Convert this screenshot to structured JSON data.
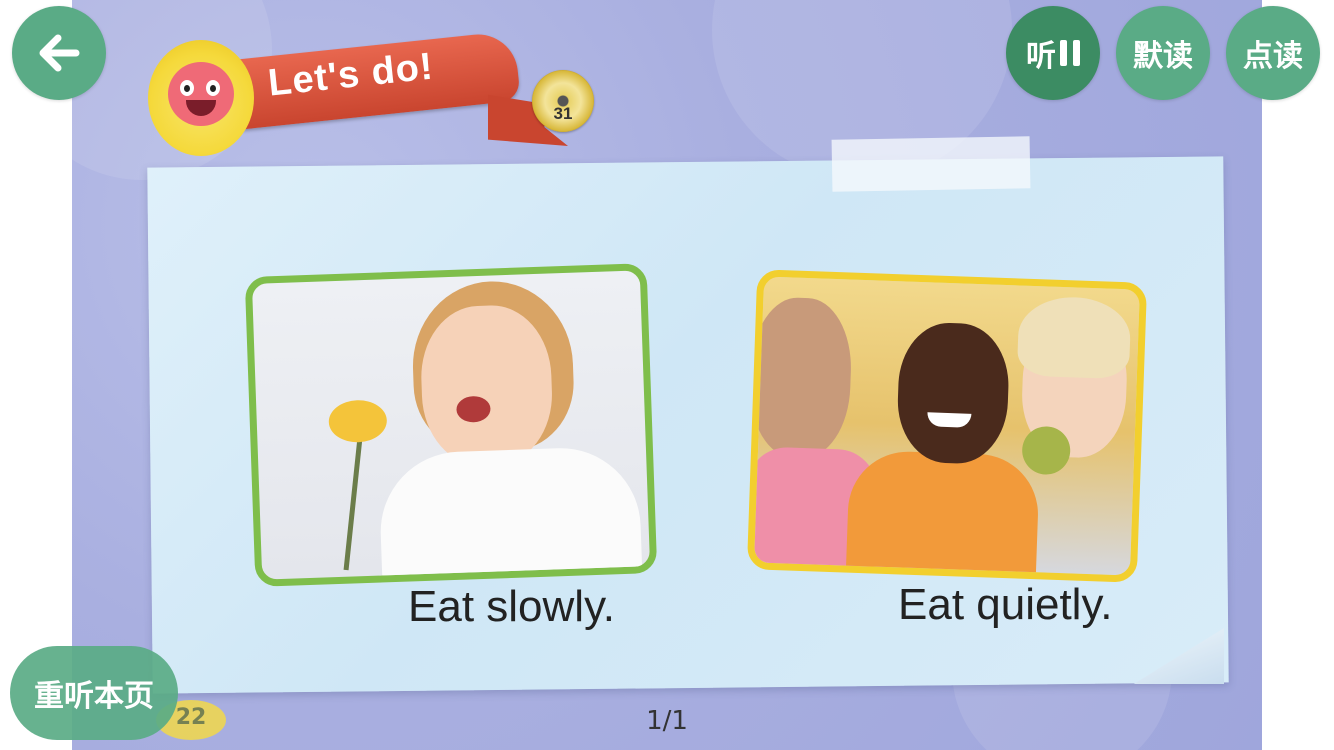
{
  "header": {
    "lesson_title": "Let's do!",
    "track_number": "31"
  },
  "toolbar": {
    "listen_label": "听",
    "silent_read_label": "默读",
    "tap_read_label": "点读"
  },
  "content": {
    "cards": [
      {
        "caption": "Eat slowly."
      },
      {
        "caption": "Eat quietly."
      }
    ],
    "printed_page_number": "22"
  },
  "footer": {
    "replay_label": "重听本页",
    "pager": "1/1"
  },
  "colors": {
    "button_green": "#5aab86",
    "active_green": "#3c8c63",
    "frame_green": "#7fbe4b",
    "frame_yellow": "#f2cf2e",
    "ribbon_red": "#d4533b"
  },
  "icons": {
    "back": "arrow-left-icon",
    "pause": "pause-icon",
    "cd": "cd-icon"
  }
}
